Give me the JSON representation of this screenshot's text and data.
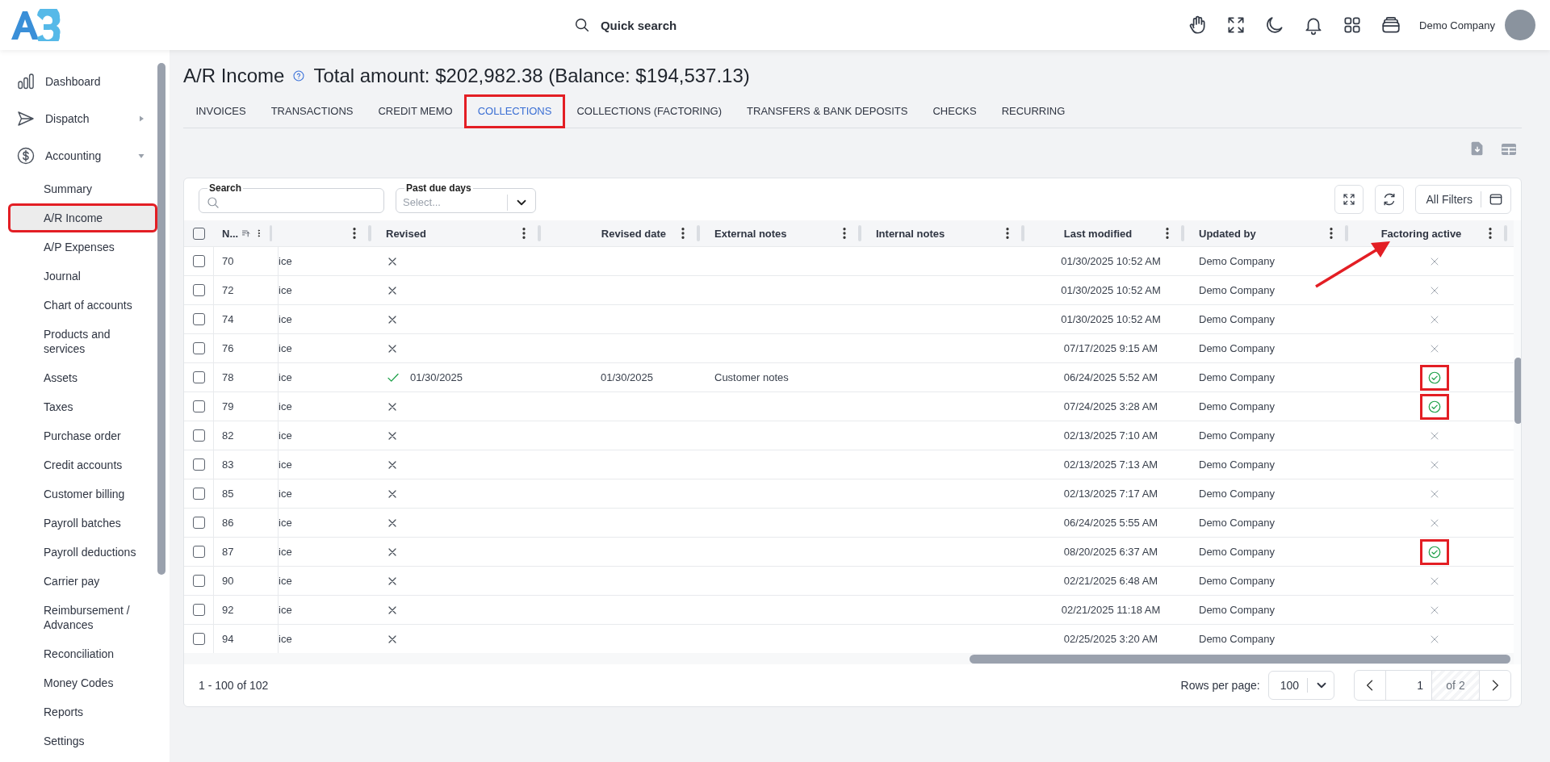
{
  "topbar": {
    "search_label": "Quick search",
    "company": "Demo Company"
  },
  "sidebar": {
    "items": [
      {
        "kind": "link",
        "label": "Dashboard"
      },
      {
        "kind": "group",
        "label": "Dispatch",
        "expanded": false
      },
      {
        "kind": "group",
        "label": "Accounting",
        "expanded": true,
        "children": [
          {
            "label": "Summary",
            "selected": false,
            "annotated": false
          },
          {
            "label": "A/R Income",
            "selected": true,
            "annotated": true
          },
          {
            "label": "A/P Expenses",
            "selected": false,
            "annotated": false
          },
          {
            "label": "Journal",
            "selected": false,
            "annotated": false
          },
          {
            "label": "Chart of accounts",
            "selected": false,
            "annotated": false
          },
          {
            "label": "Products and services",
            "selected": false,
            "annotated": false
          },
          {
            "label": "Assets",
            "selected": false,
            "annotated": false
          },
          {
            "label": "Taxes",
            "selected": false,
            "annotated": false
          },
          {
            "label": "Purchase order",
            "selected": false,
            "annotated": false
          },
          {
            "label": "Credit accounts",
            "selected": false,
            "annotated": false
          },
          {
            "label": "Customer billing",
            "selected": false,
            "annotated": false
          },
          {
            "label": "Payroll batches",
            "selected": false,
            "annotated": false
          },
          {
            "label": "Payroll deductions",
            "selected": false,
            "annotated": false
          },
          {
            "label": "Carrier pay",
            "selected": false,
            "annotated": false
          },
          {
            "label": "Reimbursement / Advances",
            "selected": false,
            "annotated": false
          },
          {
            "label": "Reconciliation",
            "selected": false,
            "annotated": false
          },
          {
            "label": "Money Codes",
            "selected": false,
            "annotated": false
          },
          {
            "label": "Reports",
            "selected": false,
            "annotated": false
          },
          {
            "label": "Settings",
            "selected": false,
            "annotated": false
          }
        ]
      }
    ]
  },
  "page": {
    "title": "A/R Income",
    "summary": "Total amount: $202,982.38 (Balance: $194,537.13)"
  },
  "tabs": [
    {
      "label": "INVOICES",
      "selected": false,
      "annotated": false
    },
    {
      "label": "TRANSACTIONS",
      "selected": false,
      "annotated": false
    },
    {
      "label": "CREDIT MEMO",
      "selected": false,
      "annotated": false
    },
    {
      "label": "COLLECTIONS",
      "selected": true,
      "annotated": true
    },
    {
      "label": "COLLECTIONS (FACTORING)",
      "selected": false,
      "annotated": false
    },
    {
      "label": "TRANSFERS & BANK DEPOSITS",
      "selected": false,
      "annotated": false
    },
    {
      "label": "CHECKS",
      "selected": false,
      "annotated": false
    },
    {
      "label": "RECURRING",
      "selected": false,
      "annotated": false
    }
  ],
  "filters": {
    "search": {
      "label": "Search"
    },
    "past_due": {
      "label": "Past due days",
      "placeholder": "Select..."
    },
    "all_filters": "All Filters"
  },
  "table": {
    "all_selected": false,
    "columns": [
      {
        "label": "N...",
        "sorted": true,
        "annotated": false
      },
      {
        "sorted": false,
        "annotated": false
      },
      {
        "label": "Revised",
        "sorted": false,
        "annotated": false
      },
      {
        "label": "Revised date",
        "sorted": false,
        "annotated": false
      },
      {
        "label": "External notes",
        "sorted": false,
        "annotated": false
      },
      {
        "label": "Internal notes",
        "sorted": false,
        "annotated": false
      },
      {
        "label": "Last modified",
        "sorted": false,
        "annotated": false
      },
      {
        "label": "Updated by",
        "sorted": false,
        "annotated": false
      },
      {
        "label": "Factoring active",
        "sorted": false,
        "annotated": true
      }
    ],
    "rows": [
      {
        "checked": false,
        "number": "70",
        "column_3": "ice",
        "revised": false,
        "last_modified": "01/30/2025 10:52 AM",
        "updated_by": "Demo Company",
        "factoring_active": false,
        "annotated": false
      },
      {
        "checked": false,
        "number": "72",
        "column_3": "ice",
        "revised": false,
        "last_modified": "01/30/2025 10:52 AM",
        "updated_by": "Demo Company",
        "factoring_active": false,
        "annotated": false
      },
      {
        "checked": false,
        "number": "74",
        "column_3": "ice",
        "revised": false,
        "last_modified": "01/30/2025 10:52 AM",
        "updated_by": "Demo Company",
        "factoring_active": false,
        "annotated": false
      },
      {
        "checked": false,
        "number": "76",
        "column_3": "ice",
        "revised": false,
        "last_modified": "07/17/2025 9:15 AM",
        "updated_by": "Demo Company",
        "factoring_active": false,
        "annotated": false
      },
      {
        "checked": false,
        "number": "78",
        "column_3": "ice",
        "revised": true,
        "revised_on": "01/30/2025",
        "revised_date": "01/30/2025",
        "external_notes": "Customer notes",
        "last_modified": "06/24/2025 5:52 AM",
        "updated_by": "Demo Company",
        "factoring_active": true,
        "annotated": true
      },
      {
        "checked": false,
        "number": "79",
        "column_3": "ice",
        "revised": false,
        "last_modified": "07/24/2025 3:28 AM",
        "updated_by": "Demo Company",
        "factoring_active": true,
        "annotated": true
      },
      {
        "checked": false,
        "number": "82",
        "column_3": "ice",
        "revised": false,
        "last_modified": "02/13/2025 7:10 AM",
        "updated_by": "Demo Company",
        "factoring_active": false,
        "annotated": false
      },
      {
        "checked": false,
        "number": "83",
        "column_3": "ice",
        "revised": false,
        "last_modified": "02/13/2025 7:13 AM",
        "updated_by": "Demo Company",
        "factoring_active": false,
        "annotated": false
      },
      {
        "checked": false,
        "number": "85",
        "column_3": "ice",
        "revised": false,
        "last_modified": "02/13/2025 7:17 AM",
        "updated_by": "Demo Company",
        "factoring_active": false,
        "annotated": false
      },
      {
        "checked": false,
        "number": "86",
        "column_3": "ice",
        "revised": false,
        "last_modified": "06/24/2025 5:55 AM",
        "updated_by": "Demo Company",
        "factoring_active": false,
        "annotated": false
      },
      {
        "checked": false,
        "number": "87",
        "column_3": "ice",
        "revised": false,
        "last_modified": "08/20/2025 6:37 AM",
        "updated_by": "Demo Company",
        "factoring_active": true,
        "annotated": true
      },
      {
        "checked": false,
        "number": "90",
        "column_3": "ice",
        "revised": false,
        "last_modified": "02/21/2025 6:48 AM",
        "updated_by": "Demo Company",
        "factoring_active": false,
        "annotated": false
      },
      {
        "checked": false,
        "number": "92",
        "column_3": "ice",
        "revised": false,
        "last_modified": "02/21/2025 11:18 AM",
        "updated_by": "Demo Company",
        "factoring_active": false,
        "annotated": false
      },
      {
        "checked": false,
        "number": "94",
        "column_3": "ice",
        "revised": false,
        "last_modified": "02/25/2025 3:20 AM",
        "updated_by": "Demo Company",
        "factoring_active": false,
        "annotated": false
      }
    ]
  },
  "footer": {
    "range": "1 - 100 of 102",
    "rows_per_page_label": "Rows per page:",
    "rows_per_page": "100",
    "page": "1",
    "page_count": "of 2"
  }
}
